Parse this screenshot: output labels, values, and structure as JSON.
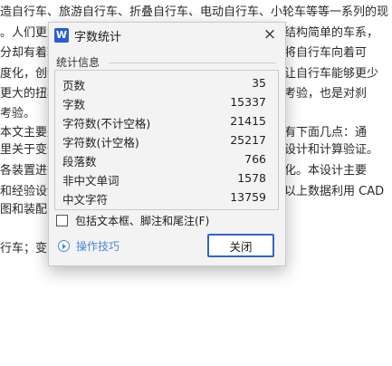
{
  "document": {
    "lines_left": [
      "造自行车、旅游自行车、折叠自行车、电动自行车、小轮车等等一系列的现",
      "。人们更加",
      "分却有着转",
      "度化，创新",
      "更大的扭转",
      "考验。",
      "本文主要是",
      "里关于变速",
      "各装置进行",
      "和经验设计",
      "图和装配图",
      "",
      "行车；变"
    ],
    "lines_right": [
      "结构简单的车系，",
      "将自行车向着可",
      "让自行车能够更少",
      "考验，也是对刹",
      "",
      "有下面几点：通",
      "设计和计算验证。",
      "化。本设计主要",
      "以上数据利用 CAD"
    ]
  },
  "dialog": {
    "app_icon": "W",
    "title": "字数统计",
    "close_icon": "×",
    "group_label": "统计信息",
    "stats": [
      {
        "label": "页数",
        "value": "35"
      },
      {
        "label": "字数",
        "value": "15337"
      },
      {
        "label": "字符数(不计空格)",
        "value": "21415"
      },
      {
        "label": "字符数(计空格)",
        "value": "25217"
      },
      {
        "label": "段落数",
        "value": "766"
      },
      {
        "label": "非中文单词",
        "value": "1578"
      },
      {
        "label": "中文字符",
        "value": "13759"
      }
    ],
    "checkbox_label": "包括文本框、脚注和尾注(F)",
    "checkbox_checked": false,
    "tips_label": "操作技巧",
    "close_button": "关闭",
    "accent_color": "#2e66c9",
    "link_color": "#4a86d6",
    "icon_names": {
      "app": "wps-writer-icon",
      "close": "close-icon",
      "tips": "play-circle-icon"
    }
  }
}
